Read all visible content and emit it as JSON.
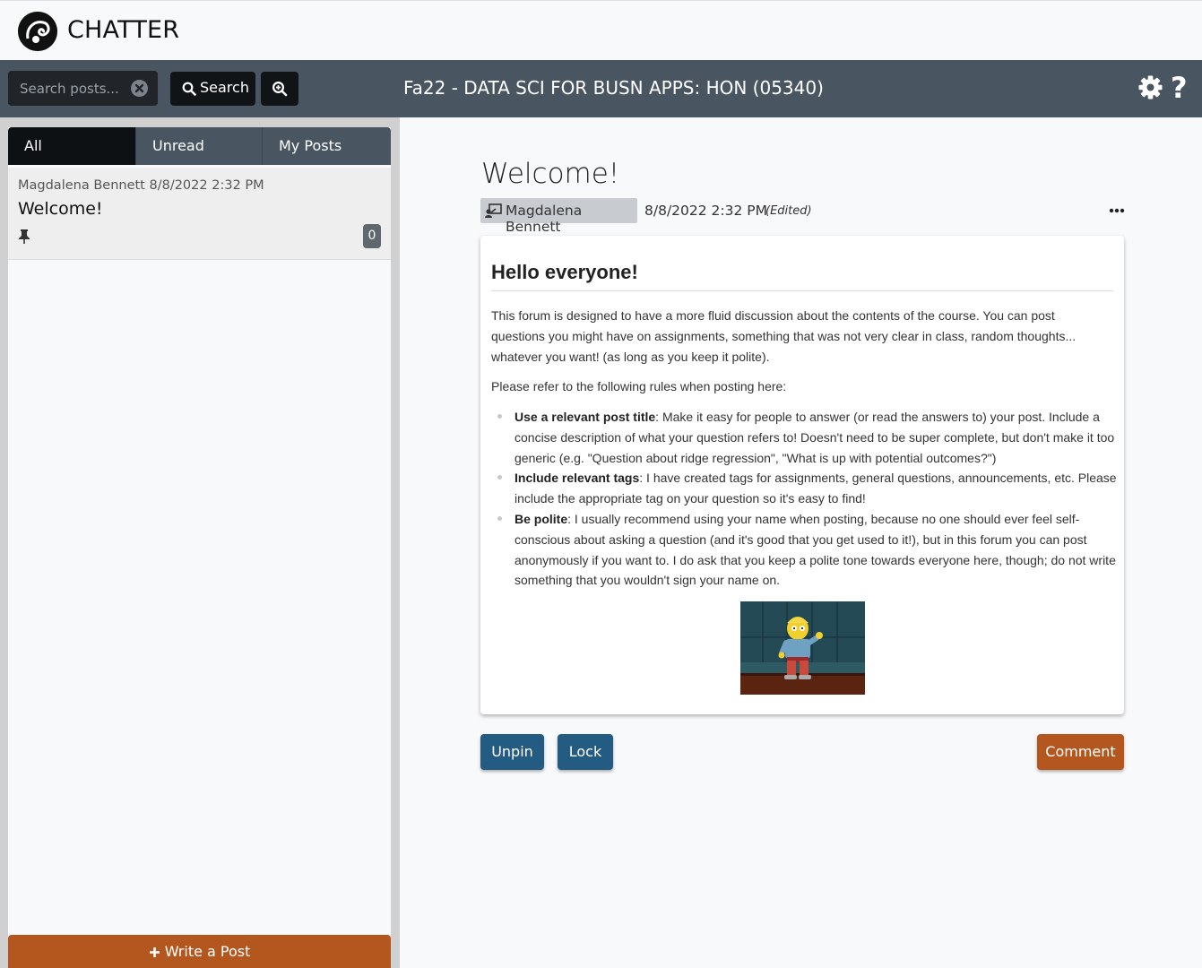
{
  "app": {
    "brand": "CHATTER",
    "course_title": "Fa22 - DATA SCI FOR BUSN APPS: HON (05340)"
  },
  "toolbar": {
    "search_placeholder": "Search posts...",
    "search_label": "Search",
    "icons": [
      "clear-search-icon",
      "search-icon",
      "zoom-in-icon",
      "gear-icon",
      "help-icon"
    ]
  },
  "sidebar": {
    "tabs": [
      "All",
      "Unread",
      "My Posts"
    ],
    "active_tab": "All",
    "posts": [
      {
        "author": "Magdalena Bennett",
        "date": "8/8/2022 2:32 PM",
        "title": "Welcome!",
        "pinned": true,
        "comment_count": "0"
      }
    ],
    "write_post_label": "Write a Post"
  },
  "post": {
    "title": "Welcome!",
    "author": "Magdalena Bennett",
    "date": "8/8/2022 2:32 PM",
    "edited": "(Edited)",
    "heading": "Hello everyone!",
    "p1": "This forum is designed to have a more fluid discussion about the contents of the course. You can post questions you might have on assignments, something that was not very clear in class, random thoughts... whatever you want! (as long as you keep it polite).",
    "p2": "Please refer to the following rules when posting here:",
    "rules": [
      {
        "bold": "Use a relevant post title",
        "text": ": Make it easy for people to answer (or read the answers to) your post. Include a concise description of what your question refers to! Doesn't need to be super complete, but don't make it too generic (e.g. \"Question about ridge regression\", \"What is up with potential outcomes?\")"
      },
      {
        "bold": "Include relevant tags",
        "text": ": I have created tags for assignments, general questions, announcements, etc. Please include the appropriate tag on your question so it's easy to find!"
      },
      {
        "bold": "Be polite",
        "text": ": I usually recommend using your name when posting, because no one should ever feel self-conscious about asking a question (and it's good that you get used to it!), but in this forum you can post anonymously if you want to. I do ask that you keep a polite tone towards everyone here, though; do not write something that you wouldn't sign your name on."
      }
    ]
  },
  "actions": {
    "unpin": "Unpin",
    "lock": "Lock",
    "comment": "Comment"
  },
  "colors": {
    "toolbar": "#4a5562",
    "primary_button": "#245b82",
    "accent": "#b4571e"
  }
}
